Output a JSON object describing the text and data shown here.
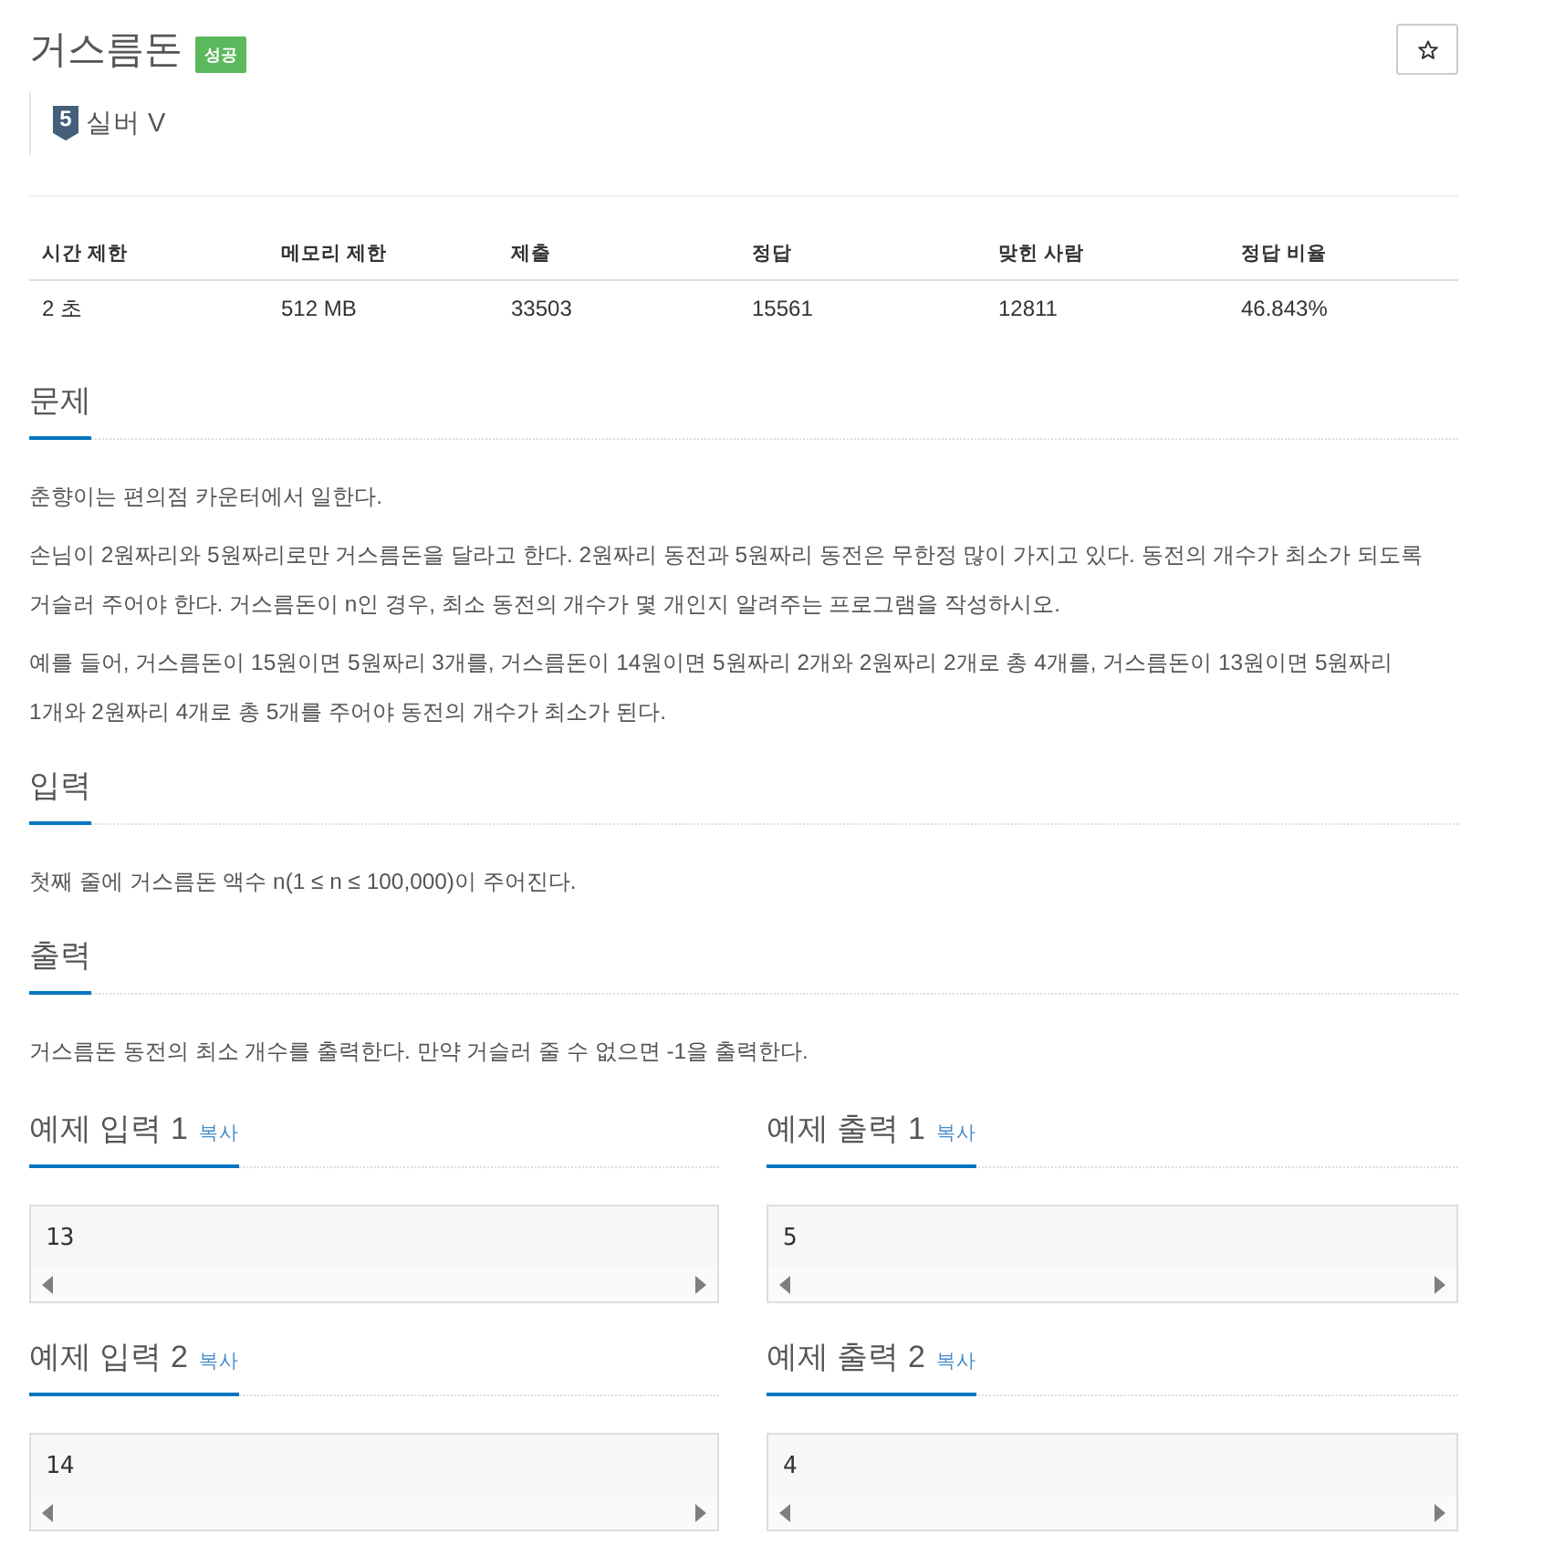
{
  "problem": {
    "title": "거스름돈",
    "result_badge": "성공"
  },
  "tier": {
    "number": "5",
    "name": "실버 V"
  },
  "stats": {
    "columns": [
      "시간 제한",
      "메모리 제한",
      "제출",
      "정답",
      "맞힌 사람",
      "정답 비율"
    ],
    "rows": [
      [
        "2 초",
        "512 MB",
        "33503",
        "15561",
        "12811",
        "46.843%"
      ]
    ]
  },
  "sections": [
    {
      "heading": "문제",
      "paragraphs": [
        "춘향이는 편의점 카운터에서 일한다.",
        "손님이 2원짜리와 5원짜리로만 거스름돈을 달라고 한다. 2원짜리 동전과 5원짜리 동전은 무한정 많이 가지고 있다. 동전의 개수가 최소가 되도록 거슬러 주어야 한다. 거스름돈이 n인 경우, 최소 동전의 개수가 몇 개인지 알려주는 프로그램을 작성하시오.",
        "예를 들어, 거스름돈이 15원이면 5원짜리 3개를, 거스름돈이 14원이면 5원짜리 2개와 2원짜리 2개로 총 4개를, 거스름돈이 13원이면 5원짜리 1개와 2원짜리 4개로 총 5개를 주어야 동전의 개수가 최소가 된다."
      ]
    },
    {
      "heading": "입력",
      "paragraphs": [
        "첫째 줄에 거스름돈 액수 n(1 ≤ n ≤ 100,000)이 주어진다."
      ]
    },
    {
      "heading": "출력",
      "paragraphs": [
        "거스름돈 동전의 최소 개수를 출력한다. 만약 거슬러 줄 수 없으면 -1을 출력한다."
      ]
    }
  ],
  "samples": [
    {
      "heading": "예제 입력 1",
      "copy_link": "복사",
      "content": "13"
    },
    {
      "heading": "예제 출력 1",
      "copy_link": "복사",
      "content": "5"
    },
    {
      "heading": "예제 입력 2",
      "copy_link": "복사",
      "content": "14"
    },
    {
      "heading": "예제 출력 2",
      "copy_link": "복사",
      "content": "4"
    }
  ]
}
